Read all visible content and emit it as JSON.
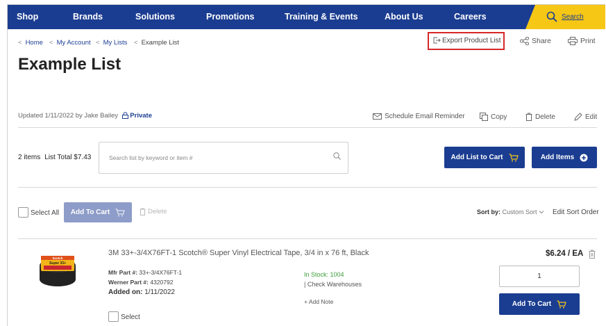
{
  "nav": {
    "items": [
      "Shop",
      "Brands",
      "Solutions",
      "Promotions",
      "Training & Events",
      "About Us",
      "Careers"
    ],
    "search_label": "Search",
    "bar_color": "#1b3d91",
    "search_color": "#f7c716"
  },
  "breadcrumb": [
    "Home",
    "My Account",
    "My Lists",
    "Example List"
  ],
  "page_title": "Example List",
  "header_actions": {
    "export": "Export Product List",
    "share": "Share",
    "print": "Print"
  },
  "list_info": {
    "updated": "Updated 1/11/2022 by Jake Bailey",
    "privacy": "Private"
  },
  "list_actions": {
    "schedule": "Schedule Email Reminder",
    "copy": "Copy",
    "delete": "Delete",
    "edit": "Edit"
  },
  "summary": {
    "items": "2 items",
    "total": "List Total $7.43",
    "search_placeholder": "Search list by keyword or item #",
    "add_list_to_cart": "Add List to Cart",
    "add_items": "Add Items"
  },
  "bulk": {
    "select_all": "Select All",
    "add_to_cart": "Add To Cart",
    "delete": "Delete",
    "sort_by_label": "Sort by:",
    "sort_by_value": "Custom Sort",
    "edit_sort_order": "Edit Sort Order"
  },
  "product": {
    "name": "3M 33+-3/4X76FT-1 Scotch® Super Vinyl Electrical Tape, 3/4 in x 76 ft, Black",
    "mfr_label": "Mfr Part #:",
    "mfr_value": "33+-3/4X76FT-1",
    "werner_label": "Werner Part #:",
    "werner_value": "4320792",
    "added_label": "Added on:",
    "added_value": "1/11/2022",
    "stock": "In Stock: 1004",
    "check_warehouses": "| Check Warehouses",
    "add_note": "+ Add Note",
    "price": "$6.24 / EA",
    "quantity": "1",
    "add_to_cart": "Add To Cart",
    "select": "Select",
    "image_text_top": "Scotch",
    "image_text_mid": "Super 33+"
  }
}
